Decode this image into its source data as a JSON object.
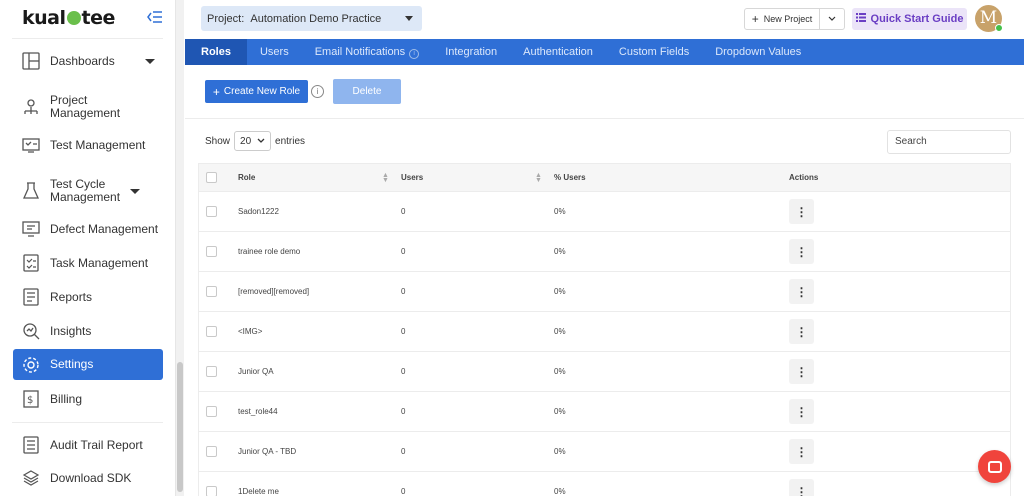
{
  "app": {
    "logo_text": "kualitee"
  },
  "sidebar": {
    "items": [
      {
        "label": "Dashboards",
        "icon": "dashboard-icon",
        "has_caret": true
      },
      {
        "label": "Project Management",
        "icon": "project-management-icon",
        "has_caret": false
      },
      {
        "label": "Test Management",
        "icon": "test-management-icon",
        "has_caret": false
      },
      {
        "label": "Test Cycle Management",
        "icon": "test-cycle-icon",
        "has_caret": true
      },
      {
        "label": "Defect Management",
        "icon": "defect-icon",
        "has_caret": false
      },
      {
        "label": "Task Management",
        "icon": "task-icon",
        "has_caret": false
      },
      {
        "label": "Reports",
        "icon": "reports-icon",
        "has_caret": false
      },
      {
        "label": "Insights",
        "icon": "insights-icon",
        "has_caret": false
      },
      {
        "label": "Settings",
        "icon": "gear-icon",
        "has_caret": false,
        "active": true
      },
      {
        "label": "Billing",
        "icon": "billing-icon",
        "has_caret": false
      },
      {
        "label": "Audit Trail Report",
        "icon": "audit-trail-icon",
        "has_caret": false
      },
      {
        "label": "Download SDK",
        "icon": "download-sdk-icon",
        "has_caret": false
      }
    ]
  },
  "header": {
    "project_prefix": "Project:",
    "project_name": "Automation Demo Practice",
    "new_project_label": "New Project",
    "quick_start_label": "Quick Start Guide",
    "avatar_initial": "M"
  },
  "tabs": [
    {
      "label": "Roles",
      "active": true
    },
    {
      "label": "Users"
    },
    {
      "label": "Email Notifications",
      "has_info": true
    },
    {
      "label": "Integration"
    },
    {
      "label": "Authentication"
    },
    {
      "label": "Custom Fields"
    },
    {
      "label": "Dropdown Values"
    }
  ],
  "actions": {
    "create_label": "Create New Role",
    "delete_label": "Delete"
  },
  "table_controls": {
    "show_label": "Show",
    "entries_value": "20",
    "entries_label": "entries",
    "search_placeholder": "Search"
  },
  "table": {
    "columns": [
      "Role",
      "Users",
      "% Users",
      "Actions"
    ],
    "rows": [
      {
        "role": "Sadon1222",
        "users": "0",
        "pct": "0%"
      },
      {
        "role": "trainee role demo",
        "users": "0",
        "pct": "0%"
      },
      {
        "role": "[removed][removed]",
        "users": "0",
        "pct": "0%"
      },
      {
        "role": "<IMG>",
        "users": "0",
        "pct": "0%"
      },
      {
        "role": "Junior QA",
        "users": "0",
        "pct": "0%"
      },
      {
        "role": "test_role44",
        "users": "0",
        "pct": "0%"
      },
      {
        "role": "Junior QA - TBD",
        "users": "0",
        "pct": "0%"
      },
      {
        "role": "1Delete me",
        "users": "0",
        "pct": "0%"
      }
    ]
  },
  "colors": {
    "primary": "#2f6fd6",
    "tab_active": "#1f56b3",
    "quick_start_bg": "#ebe4f8",
    "quick_start_text": "#6b3fc4",
    "chat": "#f0443c"
  }
}
